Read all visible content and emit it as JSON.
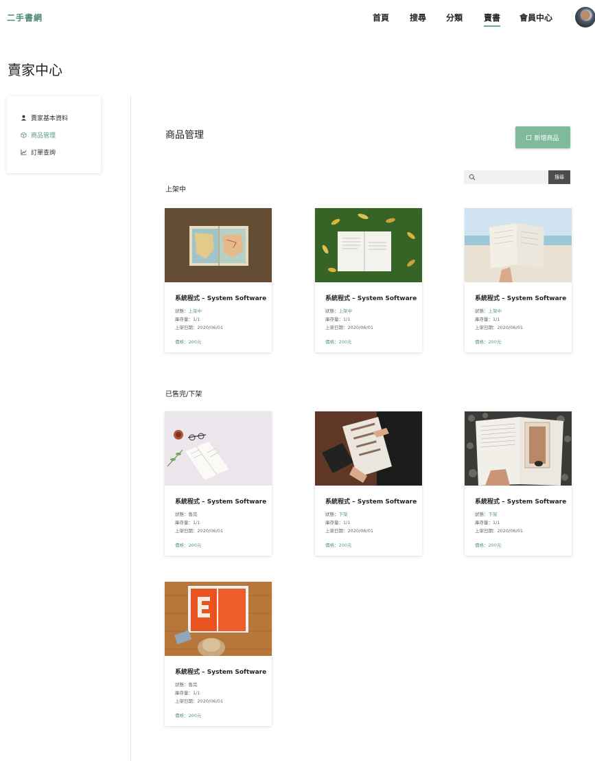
{
  "header": {
    "logo": "二手書網",
    "nav": [
      "首頁",
      "搜尋",
      "分類",
      "賣書",
      "會員中心"
    ],
    "active_nav": "賣書"
  },
  "page_title": "賣家中心",
  "sidebar": {
    "items": [
      {
        "label": "賣家基本資料",
        "icon": "user-icon",
        "active": false
      },
      {
        "label": "商品管理",
        "icon": "box-icon",
        "active": true
      },
      {
        "label": "訂單查詢",
        "icon": "chart-icon",
        "active": false
      }
    ]
  },
  "main": {
    "title": "商品管理",
    "add_button": "新增商品",
    "search_placeholder": "",
    "search_button": "搜尋"
  },
  "labels": {
    "status": "狀態：",
    "stock": "庫存量：",
    "date": "上架日期：",
    "price": "價格："
  },
  "sections": [
    {
      "title": "上架中",
      "products": [
        {
          "name": "系統程式 – System Software",
          "status": "上架中",
          "stock": "1/1",
          "date": "2020/06/01",
          "price": "200元"
        },
        {
          "name": "系統程式 – System Software",
          "status": "上架中",
          "stock": "1/1",
          "date": "2020/06/01",
          "price": "200元"
        },
        {
          "name": "系統程式 – System Software",
          "status": "上架中",
          "stock": "1/1",
          "date": "2020/06/01",
          "price": "200元"
        }
      ]
    },
    {
      "title": "已售完/下架",
      "products": [
        {
          "name": "系統程式 – System Software",
          "status": "售完",
          "stock": "1/1",
          "date": "2020/06/01",
          "price": "200元"
        },
        {
          "name": "系統程式 – System Software",
          "status": "下架",
          "stock": "1/1",
          "date": "2020/06/01",
          "price": "200元"
        },
        {
          "name": "系統程式 – System Software",
          "status": "下架",
          "stock": "1/1",
          "date": "2020/06/01",
          "price": "200元"
        },
        {
          "name": "系統程式 – System Software",
          "status": "售完",
          "stock": "1/1",
          "date": "2020/06/01",
          "price": "200元"
        }
      ]
    }
  ],
  "colors": {
    "accent": "#5b9c85",
    "button": "#7fba9d",
    "search_button": "#4d4d4d"
  }
}
